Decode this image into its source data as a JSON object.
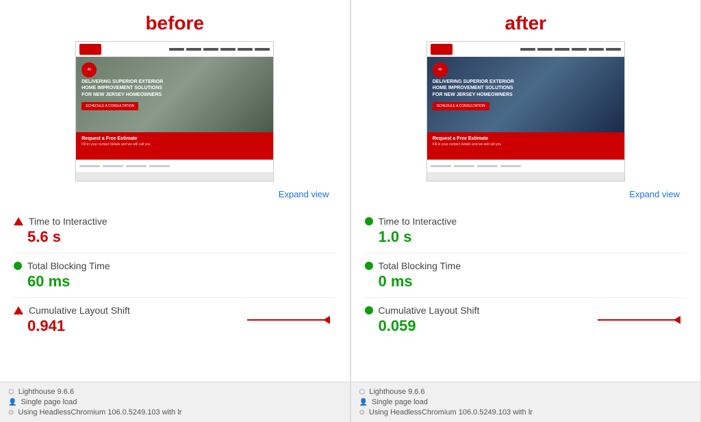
{
  "before": {
    "title": "before",
    "expand_label": "Expand view",
    "metrics": [
      {
        "name": "Time to Interactive",
        "label": "Time to Interactive",
        "value": "5.6 s",
        "type": "red",
        "indicator": "triangle"
      },
      {
        "name": "Total Blocking Time",
        "label": "Total Blocking Time",
        "value": "60 ms",
        "type": "green",
        "indicator": "circle"
      },
      {
        "name": "Cumulative Layout Shift",
        "label": "Cumulative Layout Shift",
        "value": "0.941",
        "type": "red",
        "indicator": "triangle",
        "has_arrow": true
      }
    ],
    "footer": {
      "lighthouse_version": "Lighthouse 9.6.6",
      "single_page_load": "Single page load",
      "browser": "Using HeadlessChromium 106.0.5249.103 with lr"
    }
  },
  "after": {
    "title": "after",
    "expand_label": "Expand view",
    "metrics": [
      {
        "name": "Time to Interactive",
        "label": "Time to Interactive",
        "value": "1.0 s",
        "type": "green",
        "indicator": "circle"
      },
      {
        "name": "Total Blocking Time",
        "label": "Total Blocking Time",
        "value": "0 ms",
        "type": "green",
        "indicator": "circle"
      },
      {
        "name": "Cumulative Layout Shift",
        "label": "Cumulative Layout Shift",
        "value": "0.059",
        "type": "green",
        "indicator": "circle",
        "has_arrow": true
      }
    ],
    "footer": {
      "lighthouse_version": "Lighthouse 9.6.6",
      "single_page_load": "Single page load",
      "browser": "Using HeadlessChromium 106.0.5249.103 with lr"
    }
  },
  "icons": {
    "triangle": "▲",
    "person": "👤",
    "chromium": "⊙"
  }
}
